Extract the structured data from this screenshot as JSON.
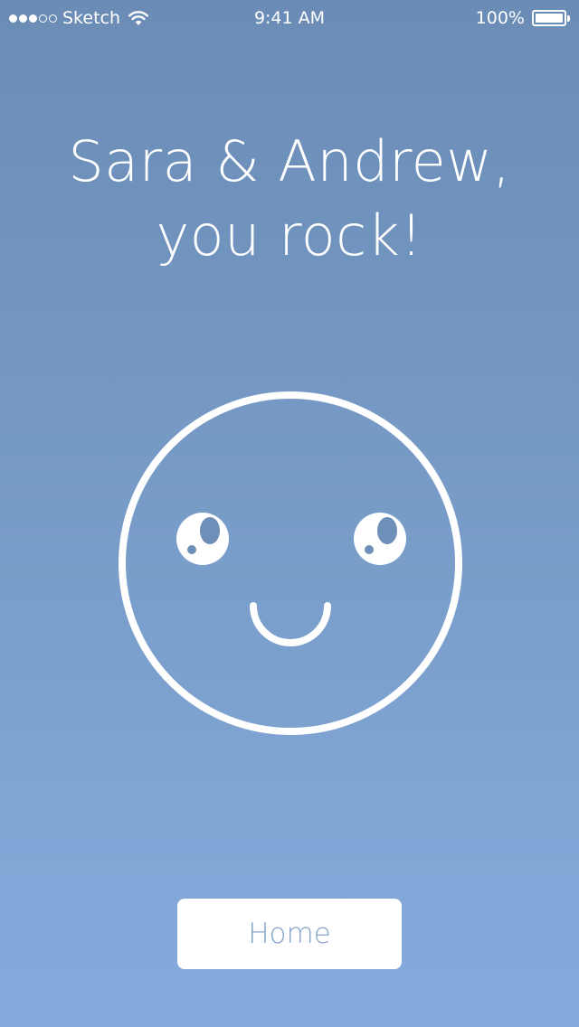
{
  "status_bar": {
    "signal_dots_filled": 3,
    "signal_dots_total": 5,
    "carrier": "Sketch",
    "wifi_icon": "wifi-icon",
    "time": "9:41 AM",
    "battery_percent": "100%",
    "battery_level": 1.0
  },
  "headline": {
    "line1": "Sara & Andrew,",
    "line2": "you rock!"
  },
  "smiley_icon": "smiley-face-icon",
  "home_button": {
    "label": "Home"
  },
  "colors": {
    "background_top": "#6a8cb5",
    "background_bottom": "#86aadd",
    "foreground": "#ffffff",
    "button_text": "#88a6c9"
  }
}
